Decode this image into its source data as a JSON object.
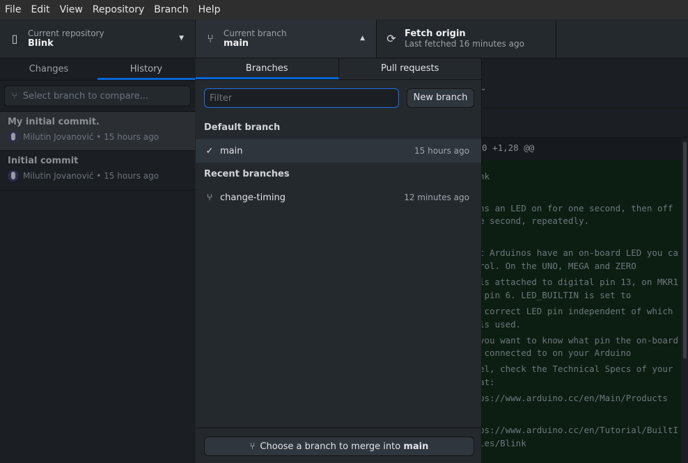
{
  "menu": [
    "File",
    "Edit",
    "View",
    "Repository",
    "Branch",
    "Help"
  ],
  "toolbar": {
    "repo": {
      "label": "Current repository",
      "value": "Blink",
      "icon": "repo-icon"
    },
    "branch": {
      "label": "Current branch",
      "value": "main",
      "icon": "git-branch-icon"
    },
    "fetch": {
      "label": "Fetch origin",
      "sub": "Last fetched 16 minutes ago",
      "icon": "sync-icon"
    }
  },
  "sidebar": {
    "tabs": [
      "Changes",
      "History"
    ],
    "active_tab": "History",
    "compare_placeholder": "Select branch to compare...",
    "commits": [
      {
        "title": "My initial commit.",
        "author": "Milutin Jovanović",
        "time": "15 hours ago"
      },
      {
        "title": "Initial commit",
        "author": "Milutin Jovanović",
        "time": "15 hours ago"
      }
    ]
  },
  "branch_popup": {
    "tabs": [
      "Branches",
      "Pull requests"
    ],
    "filter_placeholder": "Filter",
    "new_branch": "New branch",
    "default_heading": "Default branch",
    "default_branches": [
      {
        "name": "main",
        "time": "15 hours ago",
        "checked": true
      }
    ],
    "recent_heading": "Recent branches",
    "recent_branches": [
      {
        "name": "change-timing",
        "time": "12 minutes ago"
      }
    ],
    "merge_prefix": "Choose a branch to merge into ",
    "merge_target": "main"
  },
  "diff": {
    "hunk": "0 +1,28 @@",
    "lines": [
      "nk",
      "ns an LED on for one second, then off",
      "e second, repeatedly.",
      "t Arduinos have an on-board LED you ca",
      "rol. On the UNO, MEGA and ZERO",
      "is attached to digital pin 13, on MKR1",
      " pin 6. LED_BUILTIN is set to",
      " correct LED pin independent of which",
      "is used.",
      "you want to know what pin the on-board",
      " connected to on your Arduino",
      "el, check the Technical Specs of your",
      "at:",
      "ps://www.arduino.cc/en/Main/Products",
      "ps://www.arduino.cc/en/Tutorial/BuiltI",
      "les/Blink"
    ],
    "add_bg": "#0c1e12"
  },
  "colors": {
    "accent": "#0366d6"
  }
}
